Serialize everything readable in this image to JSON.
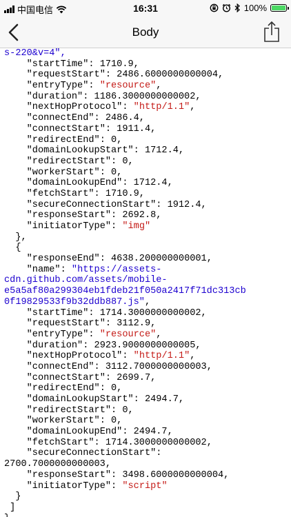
{
  "status_bar": {
    "carrier": "中国电信",
    "time": "16:31",
    "battery": "100%",
    "battery_level": 1.0
  },
  "nav": {
    "title": "Body",
    "back_icon": "chevron-left-icon",
    "share_icon": "share-icon"
  },
  "json_lines": [
    [
      {
        "t": "s-220&v=4\",",
        "c": "u"
      }
    ],
    [
      {
        "t": "    ",
        "c": "n"
      },
      {
        "t": "\"startTime\"",
        "c": "k"
      },
      {
        "t": ": 1710.9,",
        "c": "n"
      }
    ],
    [
      {
        "t": "    ",
        "c": "n"
      },
      {
        "t": "\"requestStart\"",
        "c": "k"
      },
      {
        "t": ": 2486.6000000000004,",
        "c": "n"
      }
    ],
    [
      {
        "t": "    ",
        "c": "n"
      },
      {
        "t": "\"entryType\"",
        "c": "k"
      },
      {
        "t": ": ",
        "c": "n"
      },
      {
        "t": "\"resource\"",
        "c": "s"
      },
      {
        "t": ",",
        "c": "n"
      }
    ],
    [
      {
        "t": "    ",
        "c": "n"
      },
      {
        "t": "\"duration\"",
        "c": "k"
      },
      {
        "t": ": 1186.3000000000002,",
        "c": "n"
      }
    ],
    [
      {
        "t": "    ",
        "c": "n"
      },
      {
        "t": "\"nextHopProtocol\"",
        "c": "k"
      },
      {
        "t": ": ",
        "c": "n"
      },
      {
        "t": "\"http/1.1\"",
        "c": "s"
      },
      {
        "t": ",",
        "c": "n"
      }
    ],
    [
      {
        "t": "    ",
        "c": "n"
      },
      {
        "t": "\"connectEnd\"",
        "c": "k"
      },
      {
        "t": ": 2486.4,",
        "c": "n"
      }
    ],
    [
      {
        "t": "    ",
        "c": "n"
      },
      {
        "t": "\"connectStart\"",
        "c": "k"
      },
      {
        "t": ": 1911.4,",
        "c": "n"
      }
    ],
    [
      {
        "t": "    ",
        "c": "n"
      },
      {
        "t": "\"redirectEnd\"",
        "c": "k"
      },
      {
        "t": ": 0,",
        "c": "n"
      }
    ],
    [
      {
        "t": "    ",
        "c": "n"
      },
      {
        "t": "\"domainLookupStart\"",
        "c": "k"
      },
      {
        "t": ": 1712.4,",
        "c": "n"
      }
    ],
    [
      {
        "t": "    ",
        "c": "n"
      },
      {
        "t": "\"redirectStart\"",
        "c": "k"
      },
      {
        "t": ": 0,",
        "c": "n"
      }
    ],
    [
      {
        "t": "    ",
        "c": "n"
      },
      {
        "t": "\"workerStart\"",
        "c": "k"
      },
      {
        "t": ": 0,",
        "c": "n"
      }
    ],
    [
      {
        "t": "    ",
        "c": "n"
      },
      {
        "t": "\"domainLookupEnd\"",
        "c": "k"
      },
      {
        "t": ": 1712.4,",
        "c": "n"
      }
    ],
    [
      {
        "t": "    ",
        "c": "n"
      },
      {
        "t": "\"fetchStart\"",
        "c": "k"
      },
      {
        "t": ": 1710.9,",
        "c": "n"
      }
    ],
    [
      {
        "t": "    ",
        "c": "n"
      },
      {
        "t": "\"secureConnectionStart\"",
        "c": "k"
      },
      {
        "t": ": 1912.4,",
        "c": "n"
      }
    ],
    [
      {
        "t": "    ",
        "c": "n"
      },
      {
        "t": "\"responseStart\"",
        "c": "k"
      },
      {
        "t": ": 2692.8,",
        "c": "n"
      }
    ],
    [
      {
        "t": "    ",
        "c": "n"
      },
      {
        "t": "\"initiatorType\"",
        "c": "k"
      },
      {
        "t": ": ",
        "c": "n"
      },
      {
        "t": "\"img\"",
        "c": "s"
      }
    ],
    [
      {
        "t": "  },",
        "c": "n"
      }
    ],
    [
      {
        "t": "  {",
        "c": "n"
      }
    ],
    [
      {
        "t": "    ",
        "c": "n"
      },
      {
        "t": "\"responseEnd\"",
        "c": "k"
      },
      {
        "t": ": 4638.200000000001,",
        "c": "n"
      }
    ],
    [
      {
        "t": "    ",
        "c": "n"
      },
      {
        "t": "\"name\"",
        "c": "k"
      },
      {
        "t": ": ",
        "c": "n"
      },
      {
        "t": "\"https://assets-",
        "c": "u"
      }
    ],
    [
      {
        "t": "cdn.github.com/assets/mobile-",
        "c": "u"
      }
    ],
    [
      {
        "t": "e5a5af80a299304eb1fdeb21f050a2417f71dc313cb",
        "c": "u"
      }
    ],
    [
      {
        "t": "0f19829533f9b32ddb887.js\"",
        "c": "u"
      },
      {
        "t": ",",
        "c": "n"
      }
    ],
    [
      {
        "t": "    ",
        "c": "n"
      },
      {
        "t": "\"startTime\"",
        "c": "k"
      },
      {
        "t": ": 1714.3000000000002,",
        "c": "n"
      }
    ],
    [
      {
        "t": "    ",
        "c": "n"
      },
      {
        "t": "\"requestStart\"",
        "c": "k"
      },
      {
        "t": ": 3112.9,",
        "c": "n"
      }
    ],
    [
      {
        "t": "    ",
        "c": "n"
      },
      {
        "t": "\"entryType\"",
        "c": "k"
      },
      {
        "t": ": ",
        "c": "n"
      },
      {
        "t": "\"resource\"",
        "c": "s"
      },
      {
        "t": ",",
        "c": "n"
      }
    ],
    [
      {
        "t": "    ",
        "c": "n"
      },
      {
        "t": "\"duration\"",
        "c": "k"
      },
      {
        "t": ": 2923.9000000000005,",
        "c": "n"
      }
    ],
    [
      {
        "t": "    ",
        "c": "n"
      },
      {
        "t": "\"nextHopProtocol\"",
        "c": "k"
      },
      {
        "t": ": ",
        "c": "n"
      },
      {
        "t": "\"http/1.1\"",
        "c": "s"
      },
      {
        "t": ",",
        "c": "n"
      }
    ],
    [
      {
        "t": "    ",
        "c": "n"
      },
      {
        "t": "\"connectEnd\"",
        "c": "k"
      },
      {
        "t": ": 3112.7000000000003,",
        "c": "n"
      }
    ],
    [
      {
        "t": "    ",
        "c": "n"
      },
      {
        "t": "\"connectStart\"",
        "c": "k"
      },
      {
        "t": ": 2699.7,",
        "c": "n"
      }
    ],
    [
      {
        "t": "    ",
        "c": "n"
      },
      {
        "t": "\"redirectEnd\"",
        "c": "k"
      },
      {
        "t": ": 0,",
        "c": "n"
      }
    ],
    [
      {
        "t": "    ",
        "c": "n"
      },
      {
        "t": "\"domainLookupStart\"",
        "c": "k"
      },
      {
        "t": ": 2494.7,",
        "c": "n"
      }
    ],
    [
      {
        "t": "    ",
        "c": "n"
      },
      {
        "t": "\"redirectStart\"",
        "c": "k"
      },
      {
        "t": ": 0,",
        "c": "n"
      }
    ],
    [
      {
        "t": "    ",
        "c": "n"
      },
      {
        "t": "\"workerStart\"",
        "c": "k"
      },
      {
        "t": ": 0,",
        "c": "n"
      }
    ],
    [
      {
        "t": "    ",
        "c": "n"
      },
      {
        "t": "\"domainLookupEnd\"",
        "c": "k"
      },
      {
        "t": ": 2494.7,",
        "c": "n"
      }
    ],
    [
      {
        "t": "    ",
        "c": "n"
      },
      {
        "t": "\"fetchStart\"",
        "c": "k"
      },
      {
        "t": ": 1714.3000000000002,",
        "c": "n"
      }
    ],
    [
      {
        "t": "    ",
        "c": "n"
      },
      {
        "t": "\"secureConnectionStart\"",
        "c": "k"
      },
      {
        "t": ":",
        "c": "n"
      }
    ],
    [
      {
        "t": "2700.7000000000003,",
        "c": "n"
      }
    ],
    [
      {
        "t": "    ",
        "c": "n"
      },
      {
        "t": "\"responseStart\"",
        "c": "k"
      },
      {
        "t": ": 3498.6000000000004,",
        "c": "n"
      }
    ],
    [
      {
        "t": "    ",
        "c": "n"
      },
      {
        "t": "\"initiatorType\"",
        "c": "k"
      },
      {
        "t": ": ",
        "c": "n"
      },
      {
        "t": "\"script\"",
        "c": "s"
      }
    ],
    [
      {
        "t": "  }",
        "c": "n"
      }
    ],
    [
      {
        "t": " ]",
        "c": "n"
      }
    ],
    [
      {
        "t": "}",
        "c": "n"
      }
    ]
  ]
}
